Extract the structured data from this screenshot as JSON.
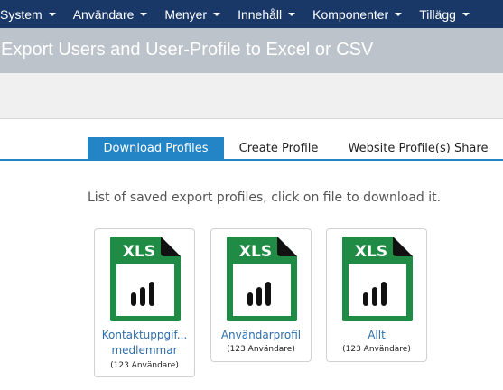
{
  "nav": {
    "items": [
      {
        "label": "System"
      },
      {
        "label": "Användare"
      },
      {
        "label": "Menyer"
      },
      {
        "label": "Innehåll"
      },
      {
        "label": "Komponenter"
      },
      {
        "label": "Tillägg"
      }
    ],
    "icon": "caret-down-icon"
  },
  "page": {
    "title": "Export Users and User-Profile to Excel or CSV"
  },
  "tabs": [
    {
      "label": "Download Profiles",
      "active": true
    },
    {
      "label": "Create Profile",
      "active": false
    },
    {
      "label": "Website Profile(s) Share",
      "active": false
    }
  ],
  "intro": "List of saved export profiles, click on file to download it.",
  "profiles": [
    {
      "name_line1": "Kontaktuppgif...",
      "name_line2": "medlemmar",
      "count": "(123 Användare)",
      "file_type": "XLS",
      "icon": "xls-file-icon"
    },
    {
      "name_line1": "Användarprofil",
      "name_line2": "",
      "count": "(123 Användare)",
      "file_type": "XLS",
      "icon": "xls-file-icon"
    },
    {
      "name_line1": "Allt",
      "name_line2": "",
      "count": "(123 Användare)",
      "file_type": "XLS",
      "icon": "xls-file-icon"
    }
  ],
  "colors": {
    "nav_bg": "#1a3867",
    "title_band": "#bcc3cb",
    "accent_blue": "#2384c6",
    "xls_green": "#1f8b45",
    "link": "#2f6ea8"
  }
}
